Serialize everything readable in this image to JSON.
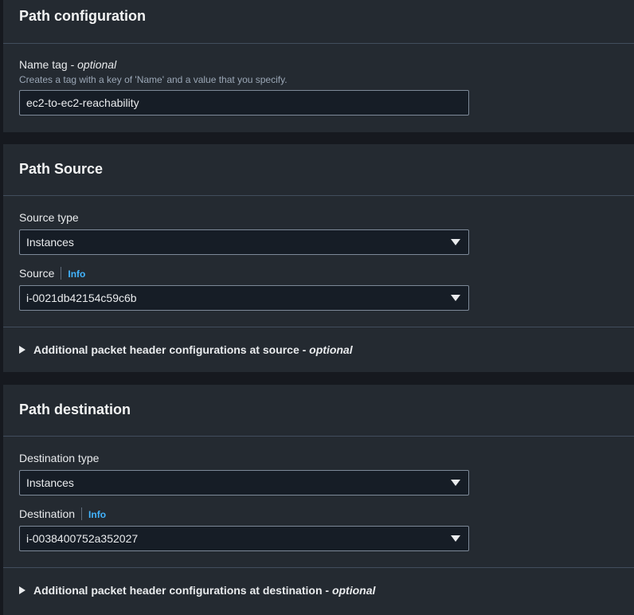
{
  "path_configuration": {
    "title": "Path configuration",
    "name_tag_label": "Name tag - ",
    "name_tag_optional": "optional",
    "name_tag_description": "Creates a tag with a key of 'Name' and a value that you specify.",
    "name_tag_value": "ec2-to-ec2-reachability"
  },
  "path_source": {
    "title": "Path Source",
    "source_type_label": "Source type",
    "source_type_value": "Instances",
    "source_label": "Source",
    "info_label": "Info",
    "source_value": "i-0021db42154c59c6b",
    "additional_label": "Additional packet header configurations at source - ",
    "additional_optional": "optional"
  },
  "path_destination": {
    "title": "Path destination",
    "destination_type_label": "Destination type",
    "destination_type_value": "Instances",
    "destination_label": "Destination",
    "info_label": "Info",
    "destination_value": "i-0038400752a352027",
    "additional_label": "Additional packet header configurations at destination - ",
    "additional_optional": "optional"
  },
  "colors": {
    "page_background": "#16191f",
    "panel_background": "#242a31",
    "input_background": "#161d26",
    "input_border": "#7d8998",
    "info_link": "#42b4ff"
  },
  "icons": [
    "dropdown-caret-icon",
    "expand-triangle-icon"
  ]
}
